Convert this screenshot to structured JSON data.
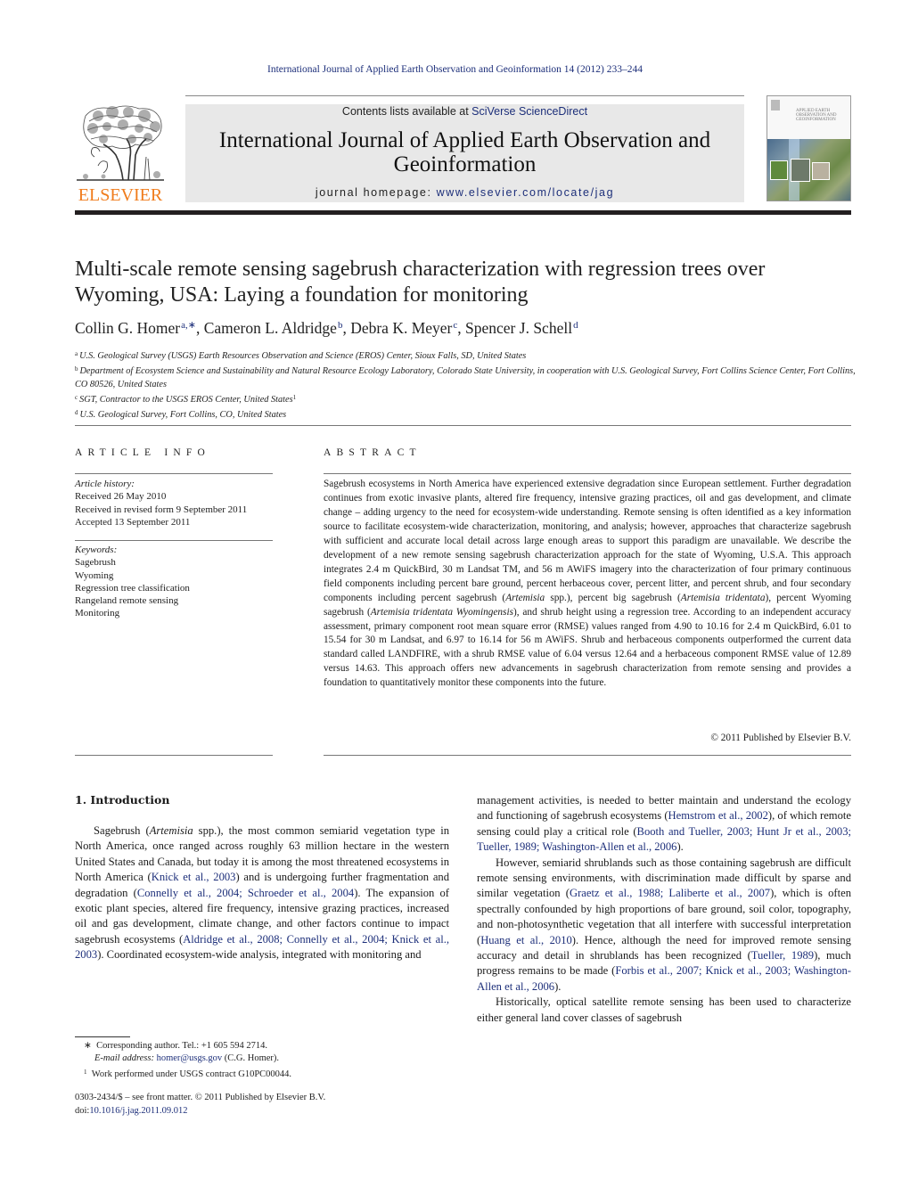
{
  "running_head": "International Journal of Applied Earth Observation and Geoinformation 14 (2012) 233–244",
  "masthead": {
    "publisher_logo_text": "ELSEVIER",
    "contents_prefix": "Contents lists available at ",
    "contents_link": "SciVerse ScienceDirect",
    "journal_title_line1": "International Journal of Applied Earth Observation and",
    "journal_title_line2": "Geoinformation",
    "homepage_prefix": "journal homepage: ",
    "homepage_link": "www.elsevier.com/locate/jag",
    "cover_title": "APPLIED EARTH OBSERVATION AND GEOINFORMATION"
  },
  "article": {
    "title": "Multi-scale remote sensing sagebrush characterization with regression trees over Wyoming, USA: Laying a foundation for monitoring",
    "authors": [
      {
        "name": "Collin G. Homer",
        "sup": "a,∗"
      },
      {
        "name": "Cameron L. Aldridge",
        "sup": "b"
      },
      {
        "name": "Debra K. Meyer",
        "sup": "c"
      },
      {
        "name": "Spencer J. Schell",
        "sup": "d"
      }
    ],
    "affiliations": [
      {
        "mark": "a",
        "text": "U.S. Geological Survey (USGS) Earth Resources Observation and Science (EROS) Center, Sioux Falls, SD, United States"
      },
      {
        "mark": "b",
        "text": "Department of Ecosystem Science and Sustainability and Natural Resource Ecology Laboratory, Colorado State University, in cooperation with U.S. Geological Survey, Fort Collins Science Center, Fort Collins, CO 80526, United States"
      },
      {
        "mark": "c",
        "text": "SGT, Contractor to the USGS EROS Center, United States",
        "sup": "1"
      },
      {
        "mark": "d",
        "text": "U.S. Geological Survey, Fort Collins, CO, United States"
      }
    ]
  },
  "article_info": {
    "heading": "ARTICLE INFO",
    "history_label": "Article history:",
    "history": [
      "Received 26 May 2010",
      "Received in revised form 9 September 2011",
      "Accepted 13 September 2011"
    ],
    "keywords_label": "Keywords:",
    "keywords": [
      "Sagebrush",
      "Wyoming",
      "Regression tree classification",
      "Rangeland remote sensing",
      "Monitoring"
    ]
  },
  "abstract": {
    "heading": "ABSTRACT",
    "segments": [
      {
        "t": "Sagebrush ecosystems in North America have experienced extensive degradation since European settlement. Further degradation continues from exotic invasive plants, altered fire frequency, intensive grazing practices, oil and gas development, and climate change – adding urgency to the need for ecosystem-wide understanding. Remote sensing is often identified as a key information source to facilitate ecosystem-wide characterization, monitoring, and analysis; however, approaches that characterize sagebrush with sufficient and accurate local detail across large enough areas to support this paradigm are unavailable. We describe the development of a new remote sensing sagebrush characterization approach for the state of Wyoming, U.S.A. This approach integrates 2.4 m QuickBird, 30 m Landsat TM, and 56 m AWiFS imagery into the characterization of four primary continuous field components including percent bare ground, percent herbaceous cover, percent litter, and percent shrub, and four secondary components including percent sagebrush ("
      },
      {
        "t": "Artemisia",
        "i": true
      },
      {
        "t": " spp.), percent big sagebrush ("
      },
      {
        "t": "Artemisia tridentata",
        "i": true
      },
      {
        "t": "), percent Wyoming sagebrush ("
      },
      {
        "t": "Artemisia tridentata Wyomingensis",
        "i": true
      },
      {
        "t": "), and shrub height using a regression tree. According to an independent accuracy assessment, primary component root mean square error (RMSE) values ranged from 4.90 to 10.16 for 2.4 m QuickBird, 6.01 to 15.54 for 30 m Landsat, and 6.97 to 16.14 for 56 m AWiFS. Shrub and herbaceous components outperformed the current data standard called LANDFIRE, with a shrub RMSE value of 6.04 versus 12.64 and a herbaceous component RMSE value of 12.89 versus 14.63. This approach offers new advancements in sagebrush characterization from remote sensing and provides a foundation to quantitatively monitor these components into the future."
      }
    ],
    "copyright": "© 2011 Published by Elsevier B.V."
  },
  "body": {
    "section_heading": "1.  Introduction",
    "left_paragraphs": [
      [
        {
          "t": "Sagebrush ("
        },
        {
          "t": "Artemisia",
          "i": true
        },
        {
          "t": " spp.), the most common semiarid vegetation type in North America, once ranged across roughly 63 million hectare in the western United States and Canada, but today it is among the most threatened ecosystems in North America ("
        },
        {
          "t": "Knick et al., 2003",
          "link": true
        },
        {
          "t": ") and is undergoing further fragmentation and degradation ("
        },
        {
          "t": "Connelly et al., 2004; Schroeder et al., 2004",
          "link": true
        },
        {
          "t": "). The expansion of exotic plant species, altered fire frequency, intensive grazing practices, increased oil and gas development, climate change, and other factors continue to impact sagebrush ecosystems ("
        },
        {
          "t": "Aldridge et al., 2008; Connelly et al., 2004; Knick et al., 2003",
          "link": true
        },
        {
          "t": "). Coordinated ecosystem-wide analysis, integrated with monitoring and"
        }
      ]
    ],
    "right_paragraphs": [
      {
        "noindent": true,
        "segs": [
          {
            "t": "management activities, is needed to better maintain and understand the ecology and functioning of sagebrush ecosystems ("
          },
          {
            "t": "Hemstrom et al., 2002",
            "link": true
          },
          {
            "t": "), of which remote sensing could play a critical role ("
          },
          {
            "t": "Booth and Tueller, 2003; Hunt Jr et al., 2003; Tueller, 1989; Washington-Allen et al., 2006",
            "link": true
          },
          {
            "t": ")."
          }
        ]
      },
      {
        "noindent": false,
        "segs": [
          {
            "t": "However, semiarid shrublands such as those containing sagebrush are difficult remote sensing environments, with discrimination made difficult by sparse and similar vegetation ("
          },
          {
            "t": "Graetz et al., 1988; Laliberte et al., 2007",
            "link": true
          },
          {
            "t": "), which is often spectrally confounded by high proportions of bare ground, soil color, topography, and non-photosynthetic vegetation that all interfere with successful interpretation ("
          },
          {
            "t": "Huang et al., 2010",
            "link": true
          },
          {
            "t": "). Hence, although the need for improved remote sensing accuracy and detail in shrublands has been recognized ("
          },
          {
            "t": "Tueller, 1989",
            "link": true
          },
          {
            "t": "), much progress remains to be made ("
          },
          {
            "t": "Forbis et al., 2007; Knick et al., 2003; Washington-Allen et al., 2006",
            "link": true
          },
          {
            "t": ")."
          }
        ]
      },
      {
        "noindent": false,
        "segs": [
          {
            "t": "Historically, optical satellite remote sensing has been used to characterize either general land cover classes of sagebrush"
          }
        ]
      }
    ]
  },
  "footnotes": {
    "corresponding_mark": "∗",
    "corresponding": "Corresponding author. Tel.: +1 605 594 2714.",
    "email_label": "E-mail address:",
    "email": "homer@usgs.gov",
    "email_suffix": " (C.G. Homer).",
    "fn1_mark": "1",
    "fn1": "Work performed under USGS contract G10PC00044.",
    "front_matter": "0303-2434/$ – see front matter. © 2011 Published by Elsevier B.V.",
    "doi_prefix": "doi:",
    "doi": "10.1016/j.jag.2011.09.012"
  },
  "colors": {
    "link": "#1d2f7a",
    "elsevier_orange": "#f07c1c",
    "masthead_bg": "#e8e8e8",
    "header_bar": "#231f20"
  }
}
